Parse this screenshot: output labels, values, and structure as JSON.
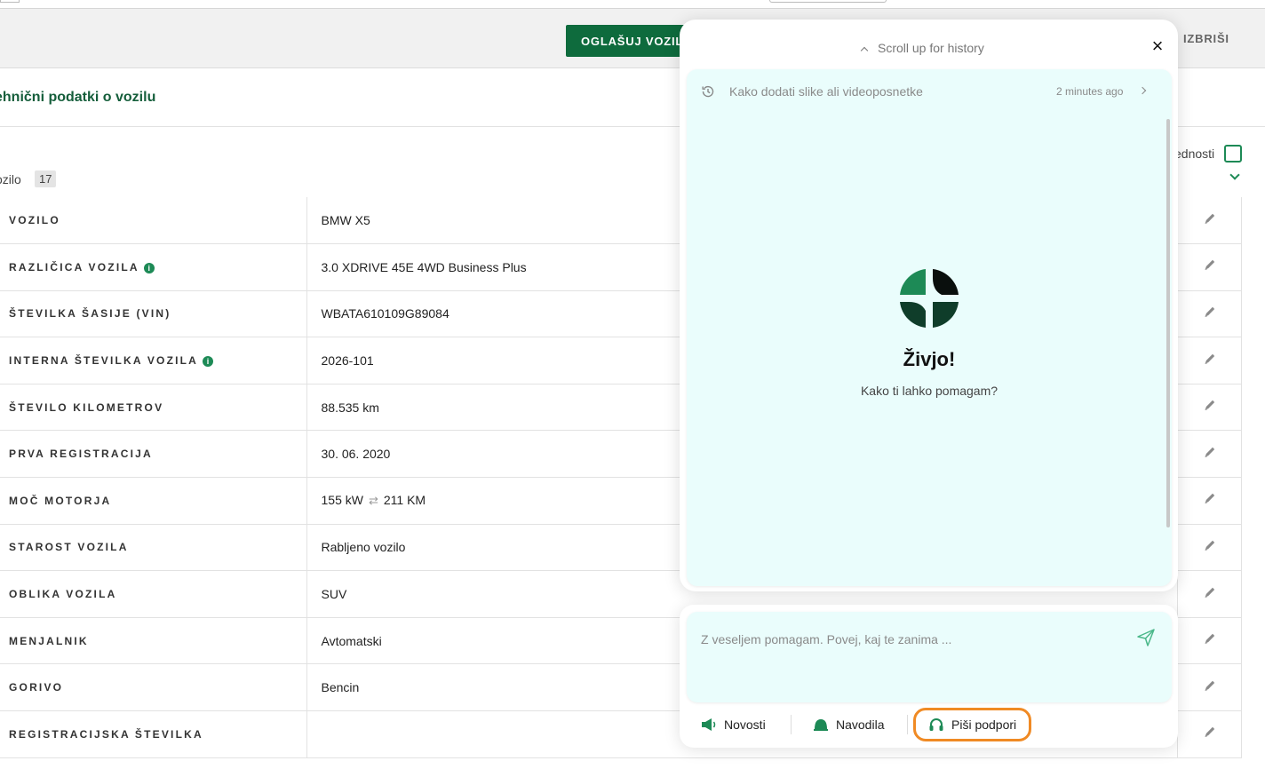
{
  "toolbar": {
    "publish_label": "OGLAŠUJ VOZIL",
    "delete_label": "IZBRIŠI"
  },
  "section": {
    "title": "ehnični podatki o vozilu",
    "filter_label": "ozilo",
    "filter_count": "17",
    "toggle_label": "ednosti"
  },
  "rows": [
    {
      "key": "VOZILO",
      "value": "BMW X5",
      "info": false
    },
    {
      "key": "RAZLIČICA VOZILA",
      "value": "3.0 XDRIVE 45E 4WD Business Plus",
      "info": true
    },
    {
      "key": "ŠTEVILKA ŠASIJE (VIN)",
      "value": "WBATA610109G89084",
      "info": false
    },
    {
      "key": "INTERNA ŠTEVILKA VOZILA",
      "value": "2026-101",
      "info": true
    },
    {
      "key": "ŠTEVILO KILOMETROV",
      "value": "88.535 km",
      "info": false
    },
    {
      "key": "PRVA REGISTRACIJA",
      "value": "30. 06. 2020",
      "info": false
    },
    {
      "key": "MOČ MOTORJA",
      "value": "155 kW",
      "value2": "211 KM",
      "info": false
    },
    {
      "key": "STAROST VOZILA",
      "value": "Rabljeno vozilo",
      "info": false
    },
    {
      "key": "OBLIKA VOZILA",
      "value": "SUV",
      "info": false
    },
    {
      "key": "MENJALNIK",
      "value": "Avtomatski",
      "info": false
    },
    {
      "key": "GORIVO",
      "value": "Bencin",
      "info": false
    },
    {
      "key": "REGISTRACIJSKA ŠTEVILKA",
      "value": "",
      "info": false
    }
  ],
  "chat": {
    "scroll_hint": "Scroll up for history",
    "history_title": "Kako dodati slike ali videoposnetke",
    "history_time": "2 minutes ago",
    "greeting": "Živjo!",
    "subtitle": "Kako ti lahko pomagam?",
    "input_placeholder": "Z veseljem pomagam. Povej, kaj te zanima ...",
    "footer": {
      "news": "Novosti",
      "guides": "Navodila",
      "support": "Piši podpori"
    }
  },
  "colors": {
    "brand_green": "#0e6b3d",
    "accent_green": "#1d8a56",
    "chat_bg": "#eafdfc",
    "highlight": "#f08a24"
  }
}
